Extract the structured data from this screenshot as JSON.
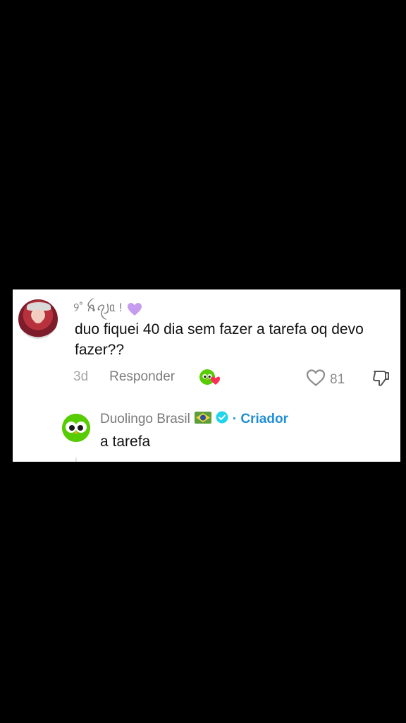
{
  "comment": {
    "username": "୨˚ ꫝꪖ꠸ᥲ !",
    "text": "duo fiquei 40 dia sem fazer a tarefa oq devo fazer??",
    "time": "3d",
    "reply_label": "Responder",
    "like_count": "81",
    "icons": {
      "badge": "purple-heart-icon",
      "creator_liked": "duolingo-heart-icon",
      "like": "heart-outline-icon",
      "dislike": "thumbs-down-icon"
    }
  },
  "reply": {
    "author": "Duolingo Brasil",
    "creator_label": "· Criador",
    "text": "a tarefa",
    "icons": {
      "flag": "brazil-flag-icon",
      "verified": "verified-badge-icon"
    },
    "colors": {
      "accent": "#1f8fd6",
      "duo_green": "#58cc02"
    }
  }
}
